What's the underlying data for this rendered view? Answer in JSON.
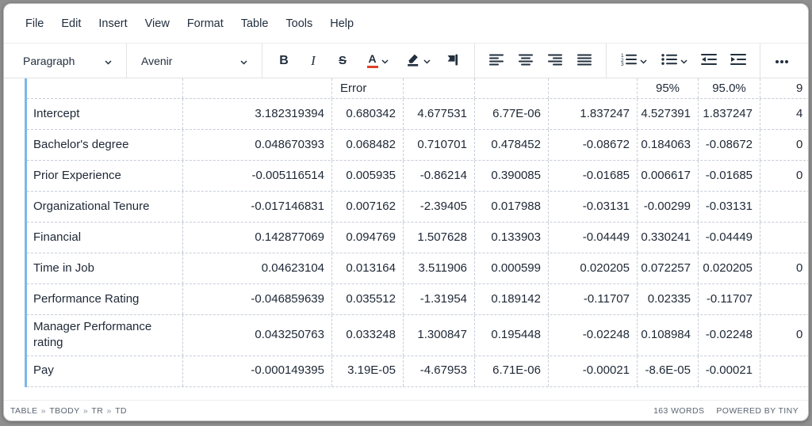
{
  "menubar": {
    "items": [
      "File",
      "Edit",
      "Insert",
      "View",
      "Format",
      "Table",
      "Tools",
      "Help"
    ]
  },
  "toolbar": {
    "style_select": "Paragraph",
    "font_select": "Avenir",
    "bold_label": "B",
    "italic_label": "I",
    "strikethrough_label": "S",
    "text_color_label": "A",
    "icons": {
      "chevron-down": "caret",
      "background-color": "highlighter-pen-with-bar",
      "format-painter": "flag-banner",
      "align-left": "bars-left",
      "align-center": "bars-center",
      "align-right": "bars-right",
      "align-justify": "bars-justify",
      "numbered-list": "numbered-bars",
      "bullet-list": "dotted-bars",
      "outdent": "bars-arrow-left",
      "indent": "bars-arrow-right",
      "more": "ellipsis-dots"
    }
  },
  "editor": {
    "table": {
      "header_fragments": [
        "",
        "",
        "Error",
        "",
        "",
        "",
        "95%",
        "95.0%",
        "9"
      ],
      "rows": [
        {
          "label": "Intercept",
          "values": [
            "3.182319394",
            "0.680342",
            "4.677531",
            "6.77E-06",
            "1.837247",
            "4.527391",
            "1.837247",
            "4"
          ]
        },
        {
          "label": "Bachelor's degree",
          "values": [
            "0.048670393",
            "0.068482",
            "0.710701",
            "0.478452",
            "-0.08672",
            "0.184063",
            "-0.08672",
            "0"
          ]
        },
        {
          "label": "Prior Experience",
          "values": [
            "-0.005116514",
            "0.005935",
            "-0.86214",
            "0.390085",
            "-0.01685",
            "0.006617",
            "-0.01685",
            "0"
          ]
        },
        {
          "label": "Organizational Tenure",
          "values": [
            "-0.017146831",
            "0.007162",
            "-2.39405",
            "0.017988",
            "-0.03131",
            "-0.00299",
            "-0.03131",
            ""
          ]
        },
        {
          "label": "Financial",
          "values": [
            "0.142877069",
            "0.094769",
            "1.507628",
            "0.133903",
            "-0.04449",
            "0.330241",
            "-0.04449",
            ""
          ]
        },
        {
          "label": "Time in Job",
          "values": [
            "0.04623104",
            "0.013164",
            "3.511906",
            "0.000599",
            "0.020205",
            "0.072257",
            "0.020205",
            "0"
          ]
        },
        {
          "label": "Performance Rating",
          "values": [
            "-0.046859639",
            "0.035512",
            "-1.31954",
            "0.189142",
            "-0.11707",
            "0.02335",
            "-0.11707",
            ""
          ]
        },
        {
          "label": "Manager Performance rating",
          "values": [
            "0.043250763",
            "0.033248",
            "1.300847",
            "0.195448",
            "-0.02248",
            "0.108984",
            "-0.02248",
            "0"
          ]
        },
        {
          "label": "Pay",
          "values": [
            "-0.000149395",
            "3.19E-05",
            "-4.67953",
            "6.71E-06",
            "-0.00021",
            "-8.6E-05",
            "-0.00021",
            ""
          ]
        }
      ]
    }
  },
  "statusbar": {
    "path_items": [
      "TABLE",
      "TBODY",
      "TR",
      "TD"
    ],
    "path_separator": "»",
    "word_count": "163 WORDS",
    "branding": "POWERED BY TINY"
  },
  "colors": {
    "accent-red": "#e03e2d",
    "selection-blue": "#7db8e8",
    "table-border": "#c6ccd8",
    "ink": "#222f3e"
  }
}
